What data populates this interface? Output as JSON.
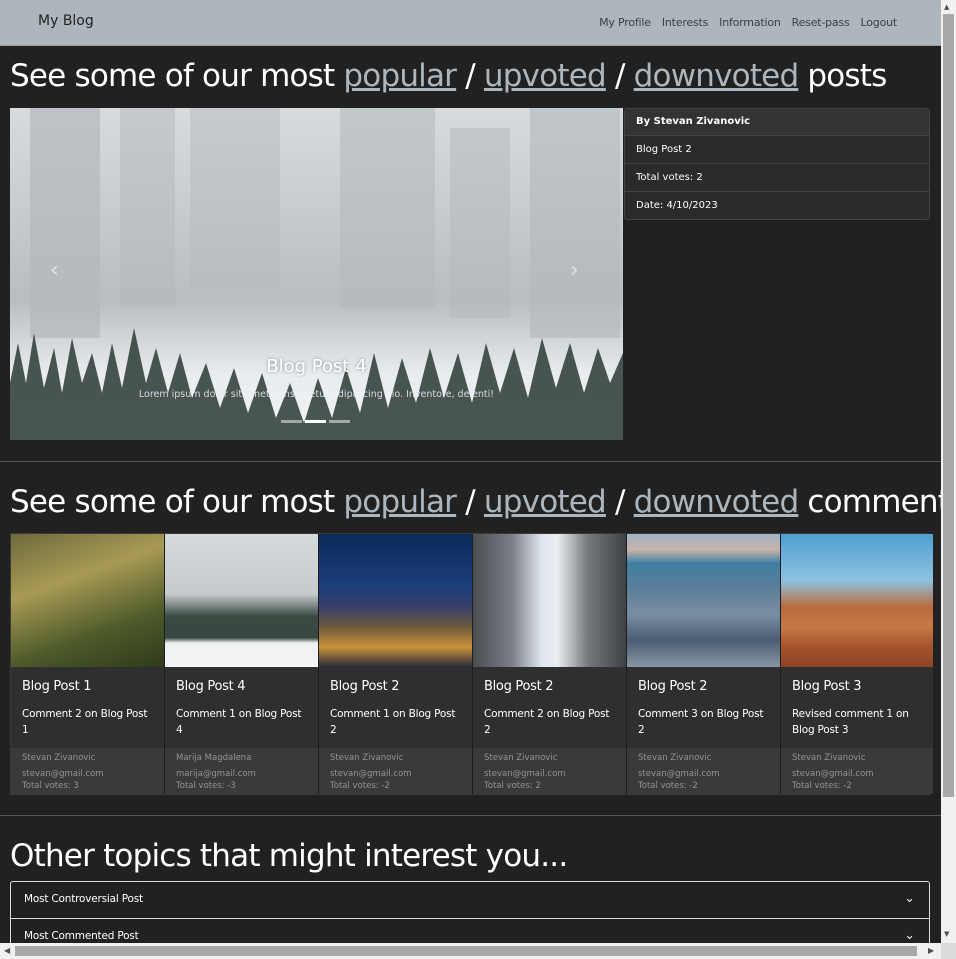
{
  "navbar": {
    "brand": "My Blog",
    "links": [
      "My Profile",
      "Interests",
      "Information",
      "Reset-pass",
      "Logout"
    ]
  },
  "posts_section": {
    "prefix": "See some of our most",
    "link_popular": "popular",
    "sep1": "/",
    "link_upvoted": "upvoted",
    "sep2": "/",
    "link_downvoted": "downvoted",
    "suffix": "posts"
  },
  "carousel": {
    "title": "Blog Post 4",
    "text": "Lorem ipsum dolor sit amet consectetur adipisicing gio. Inventore, delenti!",
    "prev_icon": "‹",
    "next_icon": "›",
    "active_slide": 2,
    "slide_count": 3
  },
  "post_info": {
    "author": "By Stevan Zivanovic",
    "title": "Blog Post 2",
    "votes": "Total votes: 2",
    "date": "Date: 4/10/2023"
  },
  "comments_section": {
    "prefix": "See some of our most",
    "link_popular": "popular",
    "sep1": "/",
    "link_upvoted": "upvoted",
    "sep2": "/",
    "link_downvoted": "downvoted",
    "suffix": "comments"
  },
  "comment_cards": [
    {
      "post": "Blog Post 1",
      "comment": "Comment 2 on Blog Post 1",
      "author": "Stevan Zivanovic",
      "email": "stevan@gmail.com",
      "votes": "Total votes: 3"
    },
    {
      "post": "Blog Post 4",
      "comment": "Comment 1 on Blog Post 4",
      "author": "Marija Magdalena",
      "email": "marija@gmail.com",
      "votes": "Total votes: -3"
    },
    {
      "post": "Blog Post 2",
      "comment": "Comment 1 on Blog Post 2",
      "author": "Stevan Zivanovic",
      "email": "stevan@gmail.com",
      "votes": "Total votes: -2"
    },
    {
      "post": "Blog Post 2",
      "comment": "Comment 2 on Blog Post 2",
      "author": "Stevan Zivanovic",
      "email": "stevan@gmail.com",
      "votes": "Total votes: 2"
    },
    {
      "post": "Blog Post 2",
      "comment": "Comment 3 on Blog Post 2",
      "author": "Stevan Zivanovic",
      "email": "stevan@gmail.com",
      "votes": "Total votes: -2"
    },
    {
      "post": "Blog Post 3",
      "comment": "Revised comment 1 on Blog Post 3",
      "author": "Stevan Zivanovic",
      "email": "stevan@gmail.com",
      "votes": "Total votes: -2"
    }
  ],
  "topics_section": {
    "title": "Other topics that might interest you...",
    "items": [
      "Most Controversial Post",
      "Most Commented Post"
    ],
    "chevron_icon": "⌄"
  },
  "colors": {
    "background": "#212121",
    "navbar": "#adb5bd",
    "link": "#adb5bd"
  }
}
